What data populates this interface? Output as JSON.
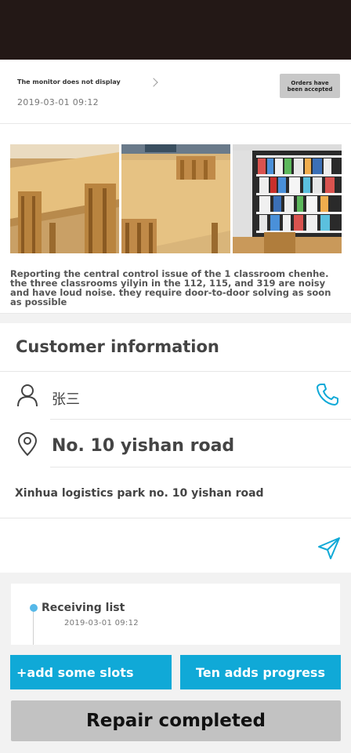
{
  "order": {
    "title": "The monitor does not display",
    "date": "2019-03-01  09:12",
    "status_badge": "Orders have been accepted"
  },
  "report": {
    "photos": [
      "classroom-tables-photo",
      "classroom-chairs-photo",
      "library-shelves-photo"
    ],
    "description": "Reporting the central control issue of the 1 classroom chenhe. the three classrooms yilyin in the 112, 115, and 319 are noisy and have loud noise. they require door-to-door solving as soon as possible"
  },
  "customer": {
    "section_title": "Customer information",
    "name": "张三",
    "address_main": "No. 10 yishan road",
    "address_detail": "Xinhua logistics park no. 10 yishan road"
  },
  "timeline": [
    {
      "title": "Receiving list",
      "date": "2019-03-01  09:12"
    }
  ],
  "actions": {
    "add_slots": "+add some slots",
    "add_progress": "Ten adds progress",
    "repair_completed": "Repair completed"
  },
  "colors": {
    "accent": "#10a9d7",
    "status_bar": "#231816",
    "badge_bg": "#c8c8c8",
    "timeline_dot": "#56b8e8"
  }
}
